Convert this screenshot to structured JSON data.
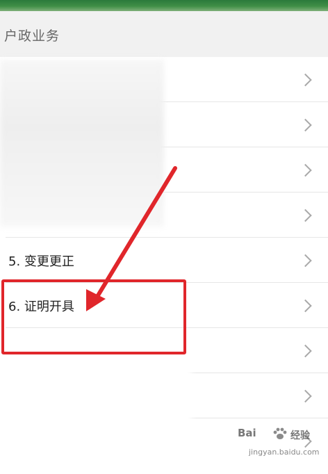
{
  "section": {
    "title": "户政业务"
  },
  "list": {
    "items": [
      {
        "label": ""
      },
      {
        "label": ""
      },
      {
        "label": ""
      },
      {
        "label": ""
      },
      {
        "label": "5. 变更更正"
      },
      {
        "label": "6. 证明开具"
      },
      {
        "label": ""
      },
      {
        "label": ""
      },
      {
        "label": ""
      }
    ]
  },
  "icons": {
    "chevron": "chevron-right-icon"
  },
  "annotation": {
    "color": "#e0262b"
  },
  "watermark": {
    "logo": "Bai",
    "text": "经验",
    "domain": "jingyan.baidu.com"
  }
}
